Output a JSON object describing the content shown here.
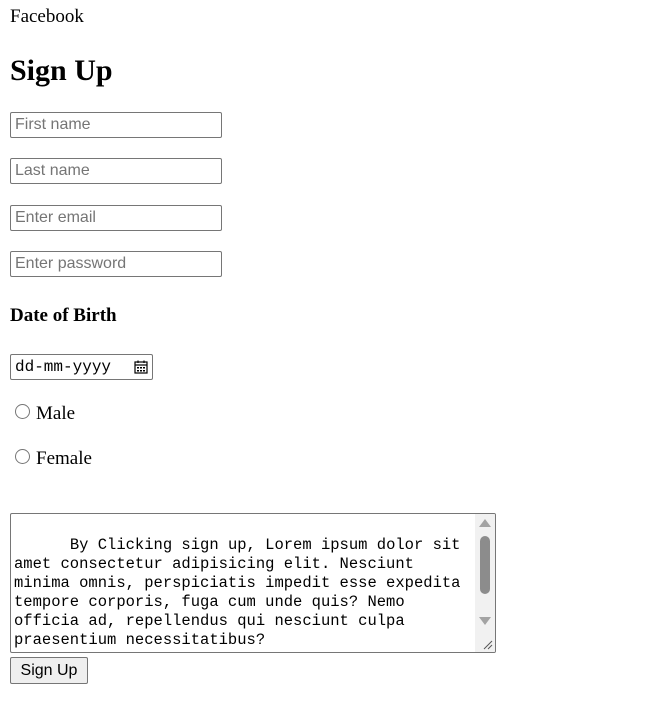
{
  "header": {
    "brand": "Facebook",
    "title": "Sign Up"
  },
  "form": {
    "first_name": {
      "placeholder": "First name",
      "value": ""
    },
    "last_name": {
      "placeholder": "Last name",
      "value": ""
    },
    "email": {
      "placeholder": "Enter email",
      "value": ""
    },
    "password": {
      "placeholder": "Enter password",
      "value": ""
    },
    "dob_heading": "Date of Birth",
    "dob_placeholder": "dd-mm-yyyy",
    "gender_options": [
      {
        "label": "Male",
        "selected": false
      },
      {
        "label": "Female",
        "selected": false
      }
    ],
    "terms_text": "      By Clicking sign up, Lorem ipsum dolor sit amet consectetur adipisicing elit. Nesciunt minima omnis, perspiciatis impedit esse expedita tempore corporis, fuga cum unde quis? Nemo officia ad, repellendus qui nesciunt culpa praesentium necessitatibus?",
    "submit_label": "Sign Up"
  },
  "icons": {
    "date_picker": "calendar-icon",
    "scroll_up": "arrow-up-icon",
    "scroll_down": "arrow-down-icon",
    "resize": "resize-grip-icon"
  },
  "colors": {
    "border": "#767676",
    "placeholder": "#757575",
    "button_bg": "#efefef",
    "scroll_thumb": "#8c8c8c"
  }
}
